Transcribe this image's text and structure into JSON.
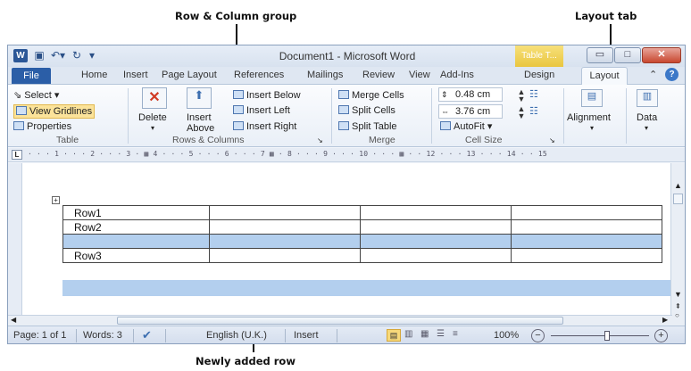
{
  "annotations": {
    "row_column_group": "Row & Column group",
    "layout_tab": "Layout tab",
    "newly_added_row": "Newly added row"
  },
  "window": {
    "title": "Document1 - Microsoft Word",
    "contextual_tab": "Table T...",
    "app_icon": "W"
  },
  "tabs": {
    "file": "File",
    "home": "Home",
    "insert": "Insert",
    "page_layout": "Page Layout",
    "references": "References",
    "mailings": "Mailings",
    "review": "Review",
    "view": "View",
    "addins": "Add-Ins",
    "design": "Design",
    "layout": "Layout"
  },
  "ribbon": {
    "table_group": {
      "select": "Select ▾",
      "view_gridlines": "View Gridlines",
      "properties": "Properties",
      "label": "Table"
    },
    "rows_columns": {
      "delete": "Delete",
      "insert_above_1": "Insert",
      "insert_above_2": "Above",
      "insert_below": "Insert Below",
      "insert_left": "Insert Left",
      "insert_right": "Insert Right",
      "label": "Rows & Columns"
    },
    "merge": {
      "merge_cells": "Merge Cells",
      "split_cells": "Split Cells",
      "split_table": "Split Table",
      "label": "Merge"
    },
    "cell_size": {
      "height": "0.48 cm",
      "width": "3.76 cm",
      "autofit": "AutoFit ▾",
      "label": "Cell Size"
    },
    "alignment": "Alignment",
    "data": "Data"
  },
  "ruler": {
    "text": "· · · 1 · · · 2 · · · 3 ·  ▦  4 · · · 5 · · · 6 · · · 7 ▦  · 8 · · · 9 · · · 10 · · ·  ▦  · · 12 · · · 13 · · · 14 · · 15"
  },
  "table": {
    "rows": [
      [
        "Row1",
        "",
        "",
        ""
      ],
      [
        "Row2",
        "",
        "",
        ""
      ],
      [
        "",
        "",
        "",
        ""
      ],
      [
        "Row3",
        "",
        "",
        ""
      ]
    ]
  },
  "statusbar": {
    "page": "Page: 1 of 1",
    "words": "Words: 3",
    "language": "English (U.K.)",
    "mode": "Insert",
    "zoom": "100%"
  },
  "colors": {
    "file_tab": "#2b5ea7",
    "selection": "#b3cfee",
    "contextual": "#e9c640"
  }
}
